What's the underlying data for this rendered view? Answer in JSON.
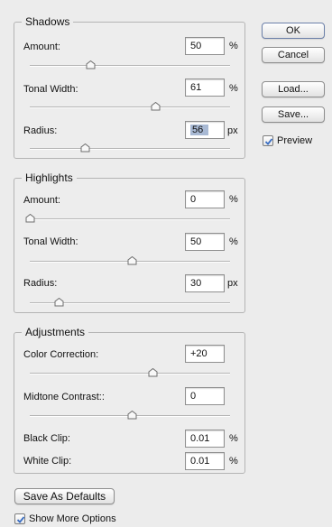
{
  "shadows": {
    "title": "Shadows",
    "amount": {
      "label": "Amount:",
      "value": "50",
      "unit": "%"
    },
    "tonal_width": {
      "label": "Tonal Width:",
      "value": "61",
      "unit": "%"
    },
    "radius": {
      "label": "Radius:",
      "value": "56",
      "unit": "px"
    }
  },
  "highlights": {
    "title": "Highlights",
    "amount": {
      "label": "Amount:",
      "value": "0",
      "unit": "%"
    },
    "tonal_width": {
      "label": "Tonal Width:",
      "value": "50",
      "unit": "%"
    },
    "radius": {
      "label": "Radius:",
      "value": "30",
      "unit": "px"
    }
  },
  "adjustments": {
    "title": "Adjustments",
    "color_correction": {
      "label": "Color Correction:",
      "value": "+20"
    },
    "midtone_contrast": {
      "label": "Midtone Contrast::",
      "value": "0"
    },
    "black_clip": {
      "label": "Black Clip:",
      "value": "0.01",
      "unit": "%"
    },
    "white_clip": {
      "label": "White Clip:",
      "value": "0.01",
      "unit": "%"
    }
  },
  "buttons": {
    "ok": "OK",
    "cancel": "Cancel",
    "load": "Load...",
    "save": "Save...",
    "save_defaults": "Save As Defaults"
  },
  "preview": {
    "label": "Preview",
    "checked": true
  },
  "show_more": {
    "label": "Show More Options",
    "checked": true
  },
  "colors": {
    "accent": "#6b7fa8",
    "selection": "#a8b9d4",
    "check": "#3b6fc4"
  }
}
